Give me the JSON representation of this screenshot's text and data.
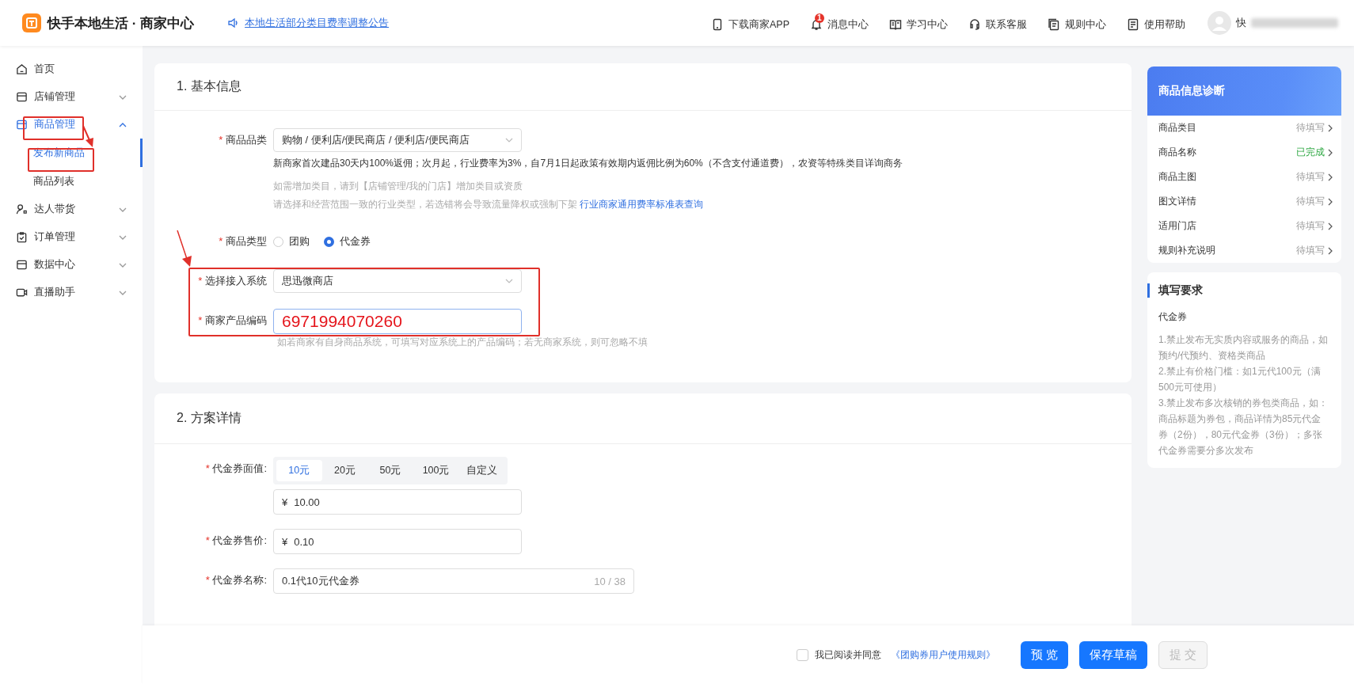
{
  "header": {
    "brand": "快手本地生活 · 商家中心",
    "announcement": "本地生活部分类目费率调整公告",
    "nav": [
      {
        "label": "下载商家APP"
      },
      {
        "label": "消息中心",
        "badge": "1"
      },
      {
        "label": "学习中心"
      },
      {
        "label": "联系客服"
      },
      {
        "label": "规则中心"
      },
      {
        "label": "使用帮助"
      }
    ],
    "user": "快"
  },
  "sidebar": {
    "items": [
      {
        "label": "首页",
        "selected": false
      },
      {
        "label": "店铺管理",
        "expanded": false,
        "selected": false
      },
      {
        "label": "商品管理",
        "expanded": true,
        "selected": true,
        "children": [
          {
            "label": "发布新商品",
            "selected": true
          },
          {
            "label": "商品列表",
            "selected": false
          }
        ]
      },
      {
        "label": "达人带货",
        "expanded": false,
        "selected": false
      },
      {
        "label": "订单管理",
        "expanded": false,
        "selected": false
      },
      {
        "label": "数据中心",
        "expanded": false,
        "selected": false
      },
      {
        "label": "直播助手",
        "expanded": false,
        "selected": false
      }
    ]
  },
  "basic_info": {
    "title": "1. 基本信息",
    "category": {
      "mark": "*",
      "label": "商品品类",
      "value": "购物 / 便利店/便民商店 / 便利店/便民商店",
      "notice": "新商家首次建品30天内100%返佣；次月起，行业费率为3%，自7月1日起政策有效期内返佣比例为60%（不含支付通道费），农资等特殊类目详询商务",
      "hint_1": "如需增加类目，请到【店铺管理/我的门店】增加类目或资质",
      "hint_2": "请选择和经营范围一致的行业类型，若选错将会导致流量降权或强制下架",
      "link": "行业商家通用费率标准表查询"
    },
    "type": {
      "mark": "*",
      "label": "商品类型",
      "options": [
        {
          "label": "团购",
          "selected": false
        },
        {
          "label": "代金券",
          "selected": true
        }
      ]
    },
    "system": {
      "mark": "*",
      "label": "选择接入系统",
      "value": "思迅微商店"
    },
    "code": {
      "mark": "*",
      "label": "商家产品编码",
      "value": "6971994070260",
      "hint": "如若商家有自身商品系统，可填写对应系统上的产品编码；若无商家系统，则可忽略不填"
    }
  },
  "plan": {
    "title": "2. 方案详情",
    "face_value": {
      "mark": "*",
      "label": "代金券面值:",
      "options": [
        {
          "label": "10元",
          "selected": true
        },
        {
          "label": "20元",
          "selected": false
        },
        {
          "label": "50元",
          "selected": false
        },
        {
          "label": "100元",
          "selected": false
        },
        {
          "label": "自定义",
          "selected": false
        }
      ],
      "currency": "¥",
      "value": "10.00"
    },
    "price": {
      "mark": "*",
      "label": "代金券售价:",
      "currency": "¥",
      "value": "0.10"
    },
    "name": {
      "mark": "*",
      "label": "代金券名称:",
      "value": "0.1代10元代金券",
      "counter": "10 / 38"
    }
  },
  "diagnosis": {
    "title": "商品信息诊断",
    "items": [
      {
        "label": "商品类目",
        "status": "待填写",
        "complete": false
      },
      {
        "label": "商品名称",
        "status": "已完成",
        "complete": true
      },
      {
        "label": "商品主图",
        "status": "待填写",
        "complete": false
      },
      {
        "label": "图文详情",
        "status": "待填写",
        "complete": false
      },
      {
        "label": "适用门店",
        "status": "待填写",
        "complete": false
      },
      {
        "label": "规则补充说明",
        "status": "待填写",
        "complete": false
      }
    ]
  },
  "requirements": {
    "title": "填写要求",
    "subtitle": "代金券",
    "lines": [
      "1.禁止发布无实质内容或服务的商品，如预约/代预约、资格类商品",
      "2.禁止有价格门槛：如1元代100元（满500元可使用）",
      "3.禁止发布多次核销的券包类商品，如：商品标题为券包，商品详情为85元代金券（2份），80元代金券（3份）；多张代金券需要分多次发布"
    ]
  },
  "footer": {
    "agree_label": "我已阅读并同意",
    "agreed": false,
    "rules_link": "《团购券用户使用规则》",
    "buttons": [
      {
        "label": "预 览",
        "disabled": false
      },
      {
        "label": "保存草稿",
        "disabled": false
      },
      {
        "label": "提 交",
        "disabled": true
      }
    ]
  }
}
